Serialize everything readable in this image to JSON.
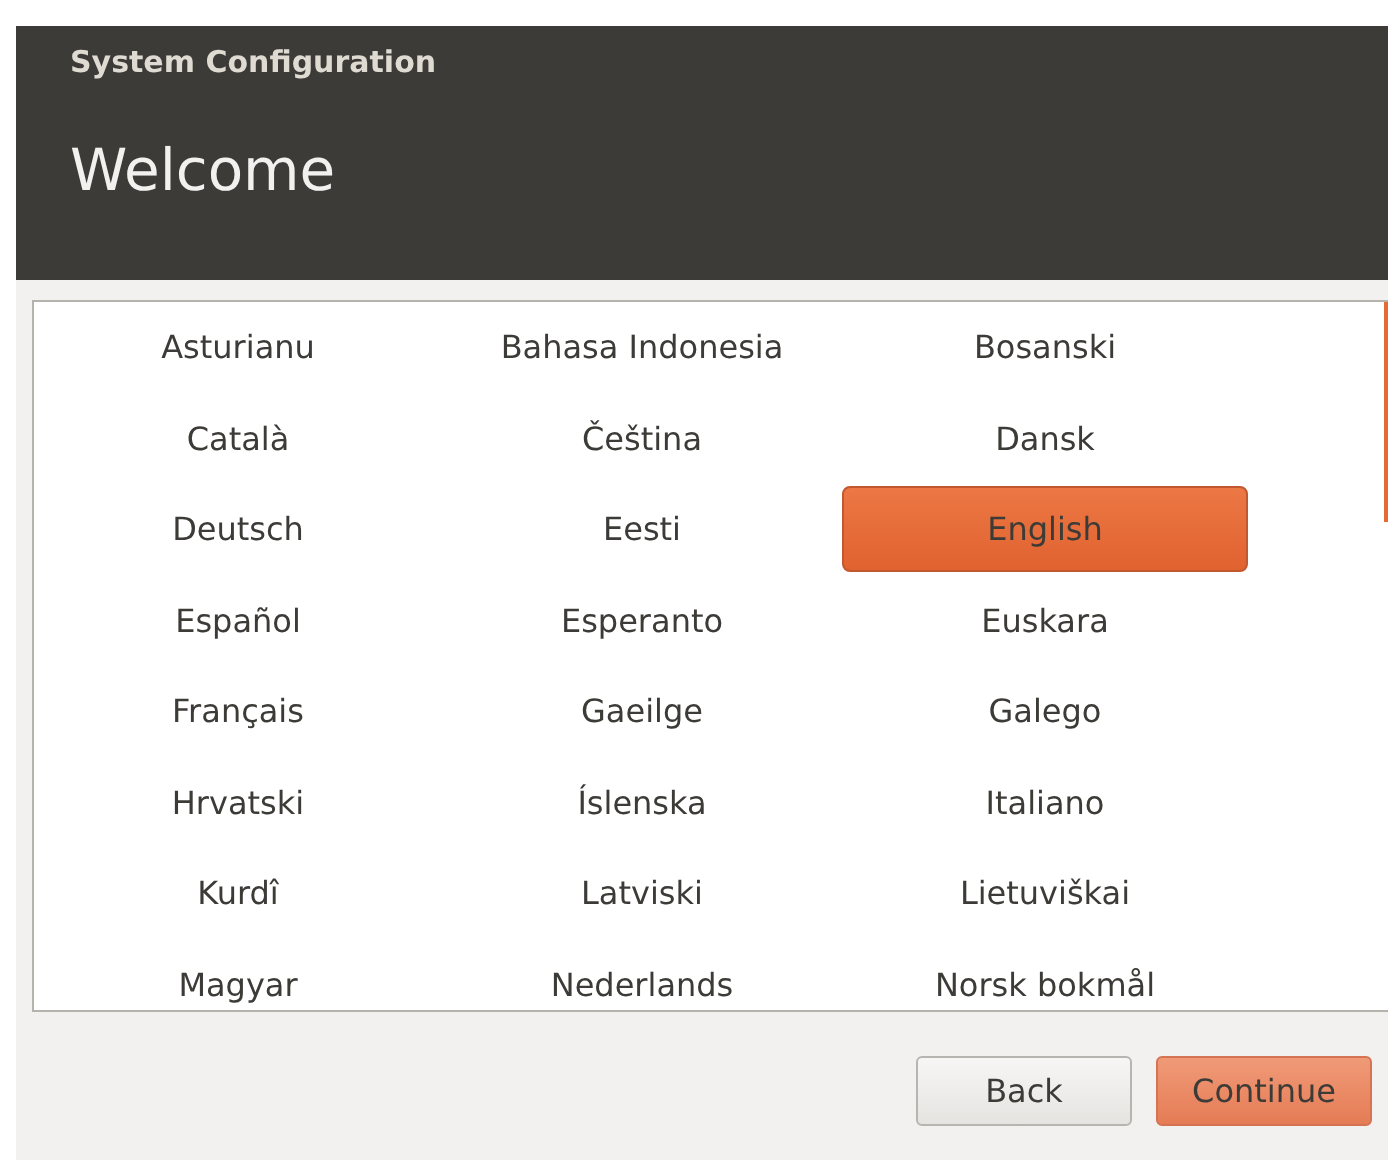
{
  "window": {
    "title": "System Configuration"
  },
  "heading": "Welcome",
  "languages": [
    {
      "label": "Asturianu",
      "selected": false
    },
    {
      "label": "Bahasa Indonesia",
      "selected": false
    },
    {
      "label": "Bosanski",
      "selected": false
    },
    {
      "label": "Català",
      "selected": false
    },
    {
      "label": "Čeština",
      "selected": false
    },
    {
      "label": "Dansk",
      "selected": false
    },
    {
      "label": "Deutsch",
      "selected": false
    },
    {
      "label": "Eesti",
      "selected": false
    },
    {
      "label": "English",
      "selected": true
    },
    {
      "label": "Español",
      "selected": false
    },
    {
      "label": "Esperanto",
      "selected": false
    },
    {
      "label": "Euskara",
      "selected": false
    },
    {
      "label": "Français",
      "selected": false
    },
    {
      "label": "Gaeilge",
      "selected": false
    },
    {
      "label": "Galego",
      "selected": false
    },
    {
      "label": "Hrvatski",
      "selected": false
    },
    {
      "label": "Íslenska",
      "selected": false
    },
    {
      "label": "Italiano",
      "selected": false
    },
    {
      "label": "Kurdî",
      "selected": false
    },
    {
      "label": "Latviski",
      "selected": false
    },
    {
      "label": "Lietuviškai",
      "selected": false
    },
    {
      "label": "Magyar",
      "selected": false
    },
    {
      "label": "Nederlands",
      "selected": false
    },
    {
      "label": "Norsk bokmål",
      "selected": false
    }
  ],
  "buttons": [
    {
      "label": "Back",
      "kind": "secondary"
    },
    {
      "label": "Continue",
      "kind": "primary"
    }
  ]
}
